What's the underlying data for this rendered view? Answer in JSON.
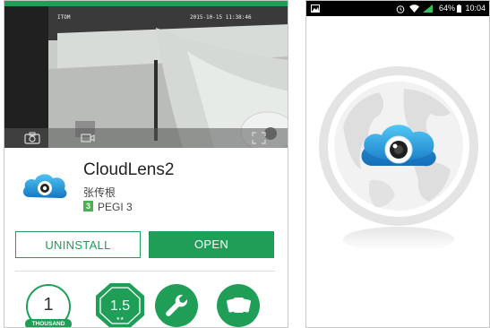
{
  "app": {
    "name": "CloudLens2",
    "developer": "张传根",
    "rating_number": "3",
    "rating_label": "PEGI 3"
  },
  "video": {
    "timestamp_left": "ITOM",
    "timestamp_right": "2015-10-15 11:38:46"
  },
  "buttons": {
    "uninstall": "UNINSTALL",
    "open": "OPEN"
  },
  "badges": {
    "downloads_number": "1",
    "downloads_label": "THOUSAND",
    "rating_value": "1.5",
    "rating_stars": "★★"
  },
  "status_bar": {
    "battery": "64%",
    "time": "10:04"
  },
  "colors": {
    "brand_green": "#1e9e57",
    "cloud_blue": "#1b95d6",
    "status_bg": "#000000"
  },
  "icons": [
    "camera-icon",
    "crop-icon",
    "wrench-icon",
    "similar-apps-icon",
    "cloud-lens-logo-icon"
  ]
}
